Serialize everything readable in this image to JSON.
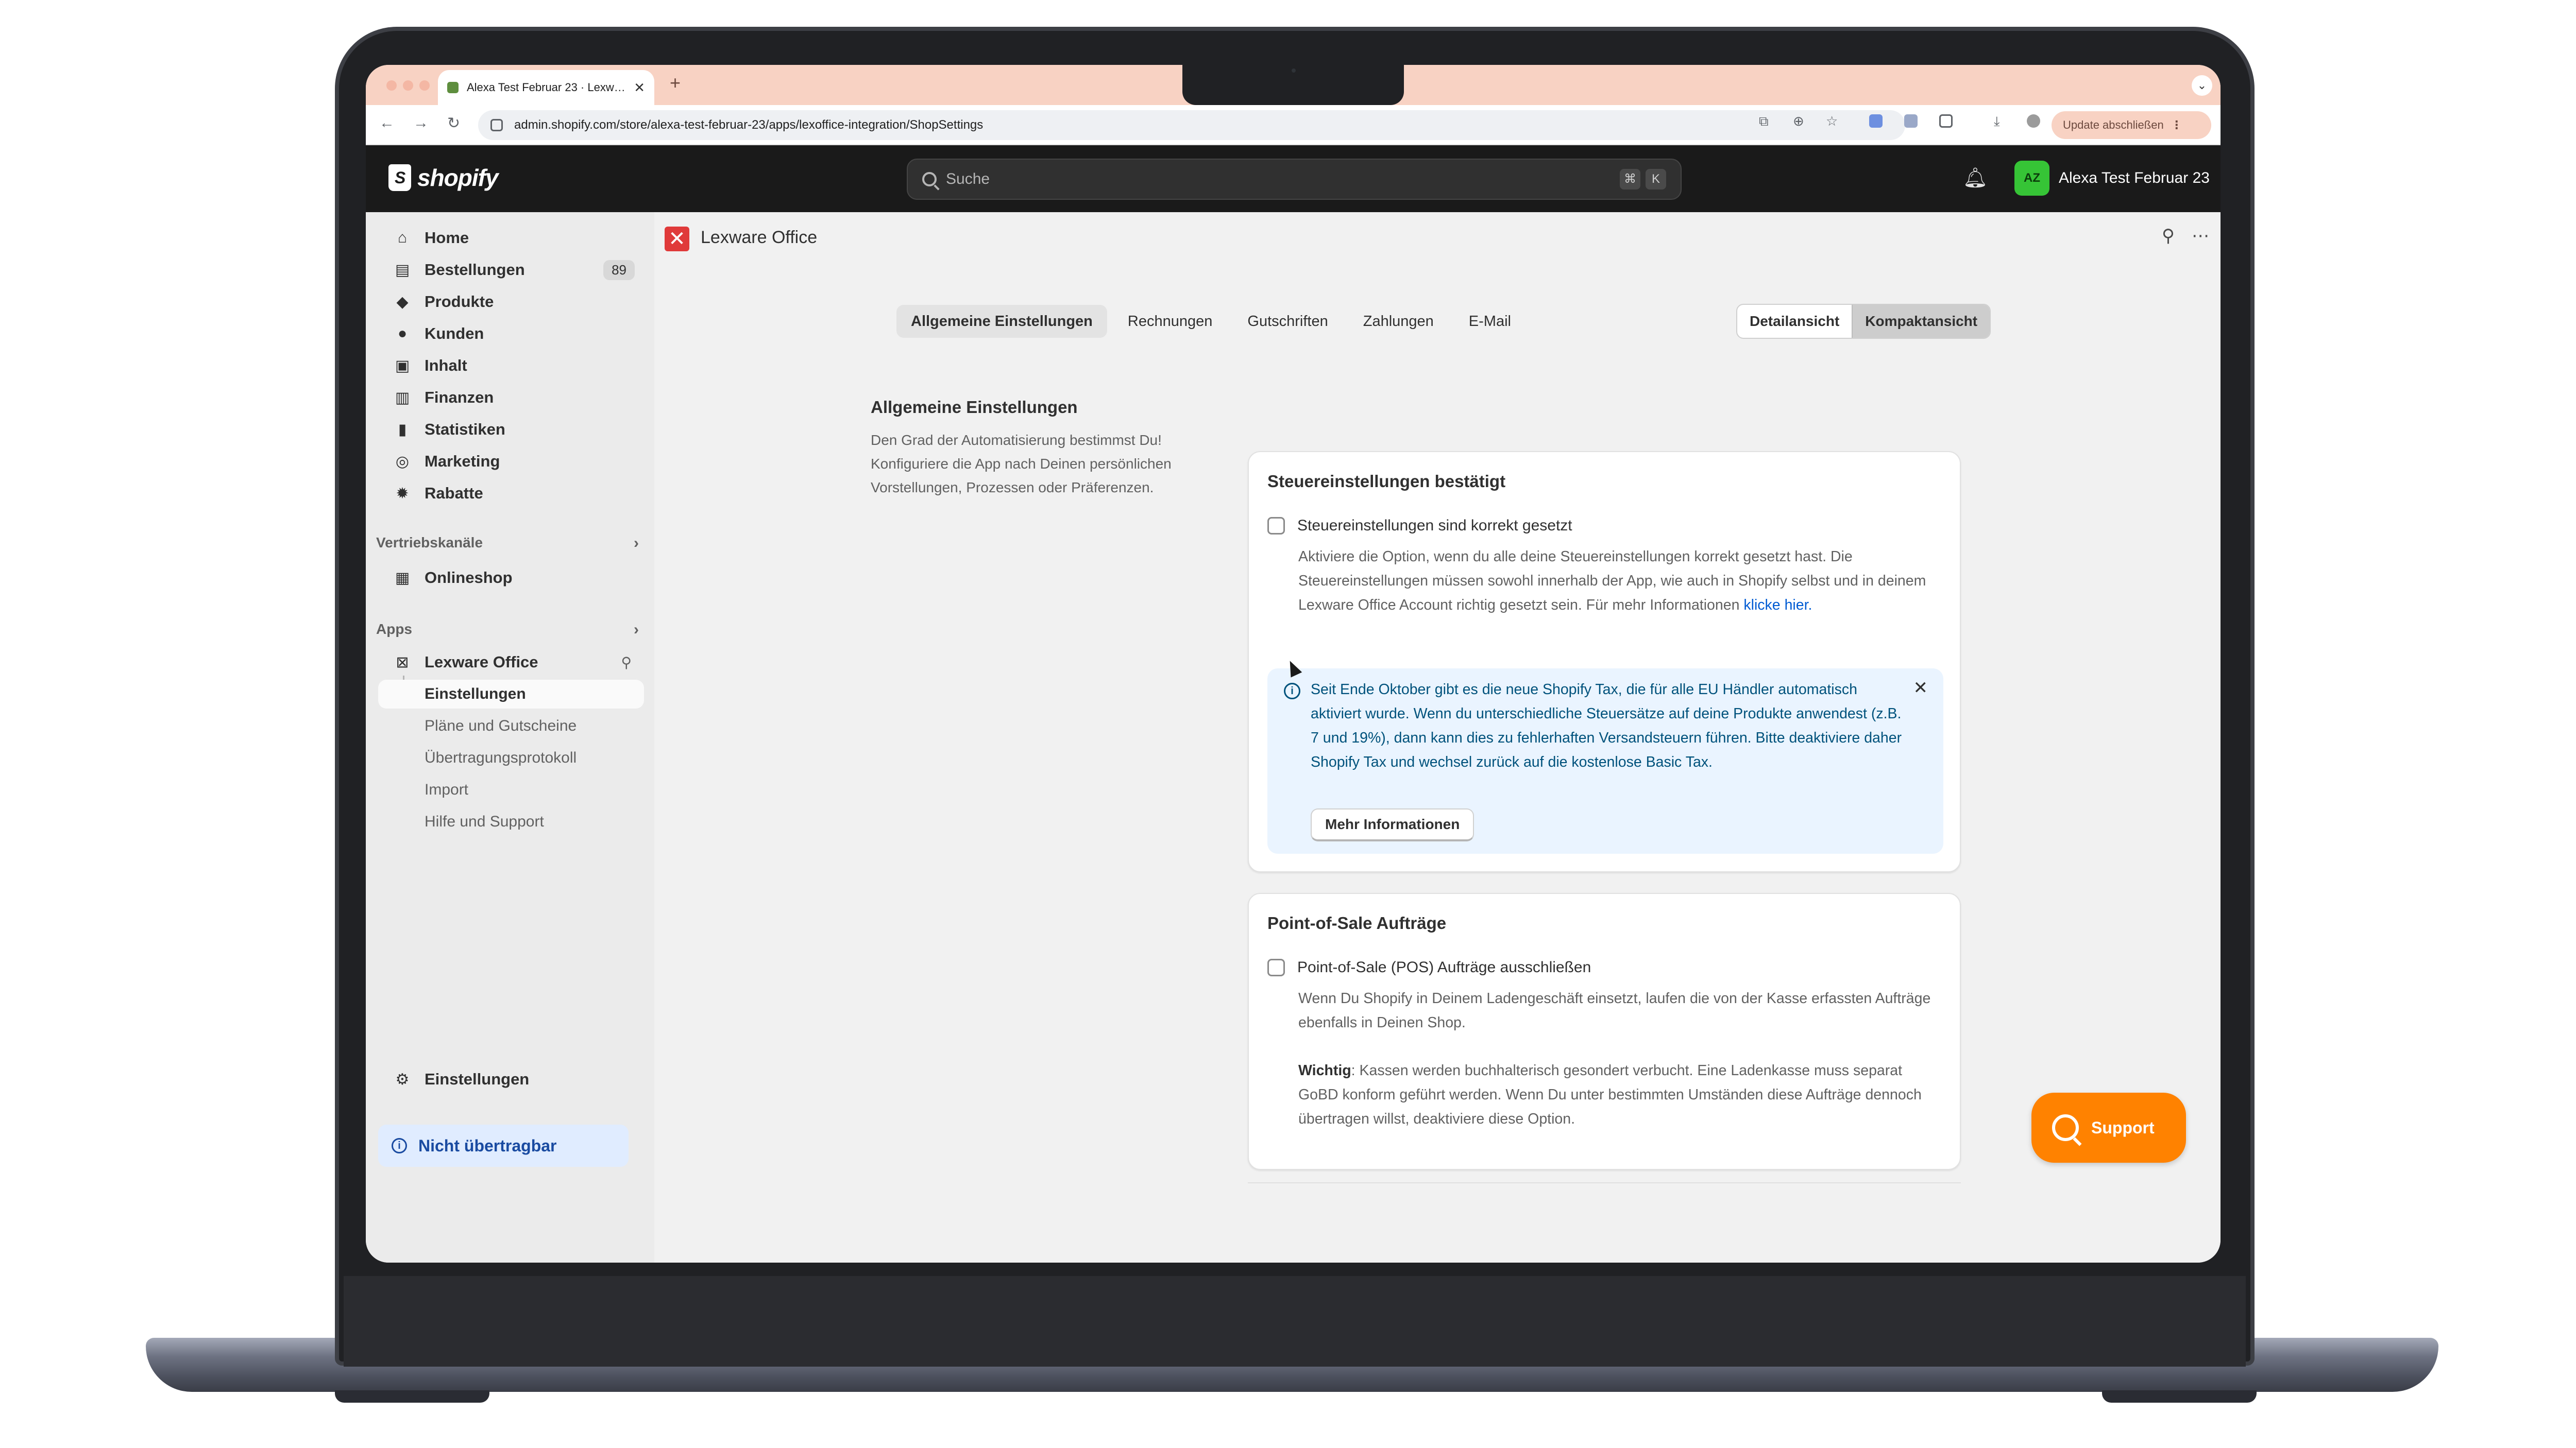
{
  "browser": {
    "tab_title": "Alexa Test Februar 23 · Lexw…",
    "tab_close": "✕",
    "new_tab": "+",
    "tab_menu": "⌄",
    "url": "admin.shopify.com/store/alexa-test-februar-23/apps/lexoffice-integration/ShopSettings",
    "update_label": "Update abschließen",
    "update_menu": "⋮"
  },
  "topbar": {
    "brand": "shopify",
    "search_placeholder": "Suche",
    "shortcut_cmd": "⌘",
    "shortcut_key": "K",
    "avatar_initials": "AZ",
    "store_name": "Alexa Test Februar 23",
    "avatar_color": "#36c436"
  },
  "sidebar": {
    "items": [
      {
        "label": "Home",
        "icon": "home-icon"
      },
      {
        "label": "Bestellungen",
        "icon": "inbox-icon",
        "badge": "89"
      },
      {
        "label": "Produkte",
        "icon": "tag-icon"
      },
      {
        "label": "Kunden",
        "icon": "person-icon"
      },
      {
        "label": "Inhalt",
        "icon": "image-icon"
      },
      {
        "label": "Finanzen",
        "icon": "bank-icon"
      },
      {
        "label": "Statistiken",
        "icon": "bar-chart-icon"
      },
      {
        "label": "Marketing",
        "icon": "target-icon"
      },
      {
        "label": "Rabatte",
        "icon": "discount-icon"
      }
    ],
    "sales_channels_label": "Vertriebskanäle",
    "onlineshop_label": "Onlineshop",
    "apps_label": "Apps",
    "app_name": "Lexware Office",
    "app_subitems": [
      "Einstellungen",
      "Pläne und Gutscheine",
      "Übertragungsprotokoll",
      "Import",
      "Hilfe und Support"
    ],
    "settings_label": "Einstellungen",
    "notice_label": "Nicht übertragbar"
  },
  "app": {
    "title": "Lexware Office",
    "tabs": [
      "Allgemeine Einstellungen",
      "Rechnungen",
      "Gutschriften",
      "Zahlungen",
      "E-Mail"
    ],
    "view_toggle": [
      "Detailansicht",
      "Kompaktansicht"
    ],
    "intro_title": "Allgemeine Einstellungen",
    "intro_text": "Den Grad der Automatisierung bestimmst Du! Konfiguriere die App nach Deinen persönlichen Vorstellungen, Prozessen oder Präferenzen.",
    "card1": {
      "title": "Steuereinstellungen bestätigt",
      "checkbox_label": "Steuereinstellungen sind korrekt gesetzt",
      "description": "Aktiviere die Option, wenn du alle deine Steuereinstellungen korrekt gesetzt hast. Die Steuereinstellungen müssen sowohl innerhalb der App, wie auch in Shopify selbst und in deinem Lexware Office Account richtig gesetzt sein. Für mehr Informationen",
      "link": "klicke hier.",
      "banner_text": "Seit Ende Oktober gibt es die neue Shopify Tax, die für alle EU Händler automatisch aktiviert wurde. Wenn du unterschiedliche Steuersätze auf deine Produkte anwendest (z.B. 7 und 19%), dann kann dies zu fehlerhaften Versandsteuern führen. Bitte deaktiviere daher Shopify Tax und wechsel zurück auf die kostenlose Basic Tax.",
      "banner_close": "✕",
      "banner_button": "Mehr Informationen"
    },
    "card2": {
      "title": "Point-of-Sale Aufträge",
      "checkbox_label": "Point-of-Sale (POS) Aufträge ausschließen",
      "description": "Wenn Du Shopify in Deinem Ladengeschäft einsetzt, laufen die von der Kasse erfassten Aufträge ebenfalls in Deinen Shop.",
      "important_label": "Wichtig",
      "important_text": ": Kassen werden buchhalterisch gesondert verbucht. Eine Ladenkasse muss separat GoBD konform geführt werden. Wenn Du unter bestimmten Umständen diese Aufträge dennoch übertragen willst, deaktiviere diese Option."
    },
    "support_label": "Support",
    "support_color": "#ff8200"
  }
}
